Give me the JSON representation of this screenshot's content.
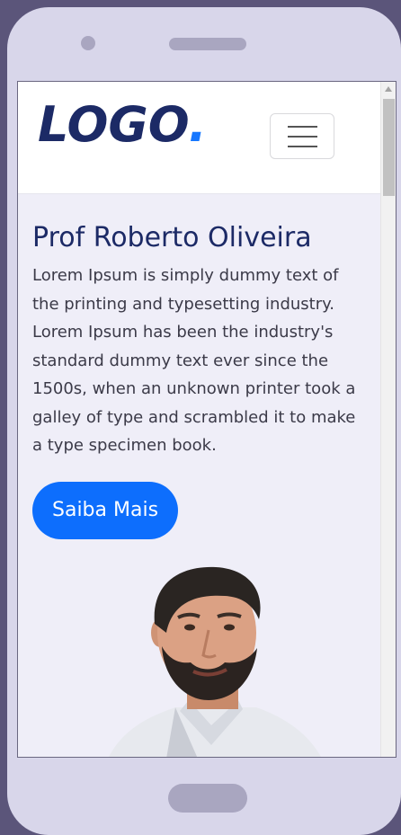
{
  "navbar": {
    "logo_text": "LOGO",
    "logo_dot": ".",
    "menu_icon": "hamburger-menu-icon"
  },
  "hero": {
    "title": "Prof Roberto Oliveira",
    "description": "Lorem Ipsum is simply dummy text of the printing and typesetting industry. Lorem Ipsum has been the industry's standard dummy text ever since the 1500s, when an unknown printer took a galley of type and scrambled it to make a type specimen book.",
    "cta_label": "Saiba Mais"
  },
  "colors": {
    "brand_dark": "#1c2a66",
    "accent_blue": "#0d6efd",
    "logo_dot": "#1677ff",
    "page_bg": "#efeef8"
  }
}
